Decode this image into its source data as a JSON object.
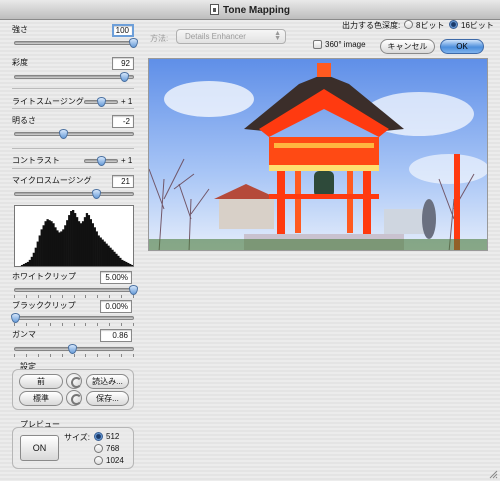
{
  "window": {
    "title": "Tone Mapping"
  },
  "method": {
    "label": "方法:",
    "selected": "Details Enhancer"
  },
  "bit_depth": {
    "label": "出力する色深度:",
    "option_8": "8ビット",
    "option_16": "16ビット",
    "selected": "16ビット"
  },
  "panorama": {
    "label": "360° image",
    "checked": false
  },
  "buttons": {
    "cancel": "キャンセル",
    "ok": "OK"
  },
  "sliders": [
    {
      "label": "強さ",
      "value": "100",
      "position": 1.0
    },
    {
      "label": "彩度",
      "value": "92",
      "position": 0.92
    },
    {
      "label": "ライトスムージング",
      "value": "+ 1",
      "position": 0.5
    },
    {
      "label": "明るさ",
      "value": "-2",
      "position": 0.41
    },
    {
      "label": "コントラスト",
      "value": "+ 1",
      "position": 0.5
    },
    {
      "label": "マイクロスムージング",
      "value": "21",
      "position": 0.69
    },
    {
      "label": "ホワイトクリップ",
      "value": "5.00%",
      "position": 1.0
    },
    {
      "label": "ブラッククリップ",
      "value": "0.00%",
      "position": 0.0
    },
    {
      "label": "ガンマ",
      "value": "0.86",
      "position": 0.48
    }
  ],
  "settings": {
    "group_label": "設定",
    "previous": "前",
    "load": "読込み...",
    "default": "標準",
    "save": "保存..."
  },
  "preview": {
    "group_label": "プレビュー",
    "on_button": "ON",
    "size_label": "サイズ:",
    "sizes": [
      "512",
      "768",
      "1024"
    ],
    "selected_size": "512"
  },
  "histogram": {
    "bins": [
      0,
      0,
      0,
      1,
      2,
      3,
      4,
      6,
      9,
      13,
      18,
      24,
      30,
      36,
      40,
      44,
      46,
      45,
      44,
      42,
      38,
      35,
      33,
      34,
      36,
      40,
      45,
      50,
      54,
      55,
      52,
      48,
      44,
      42,
      44,
      48,
      52,
      50,
      46,
      42,
      38,
      34,
      30,
      28,
      26,
      24,
      22,
      20,
      18,
      16,
      14,
      12,
      10,
      8,
      6,
      5,
      4,
      3,
      2,
      1
    ]
  },
  "photo": {
    "description_icon": "photo-preview-icon"
  },
  "colors": {
    "accent": "#4d8fdc",
    "sky": "#7fa8f0",
    "temple": "#ff3a10"
  }
}
